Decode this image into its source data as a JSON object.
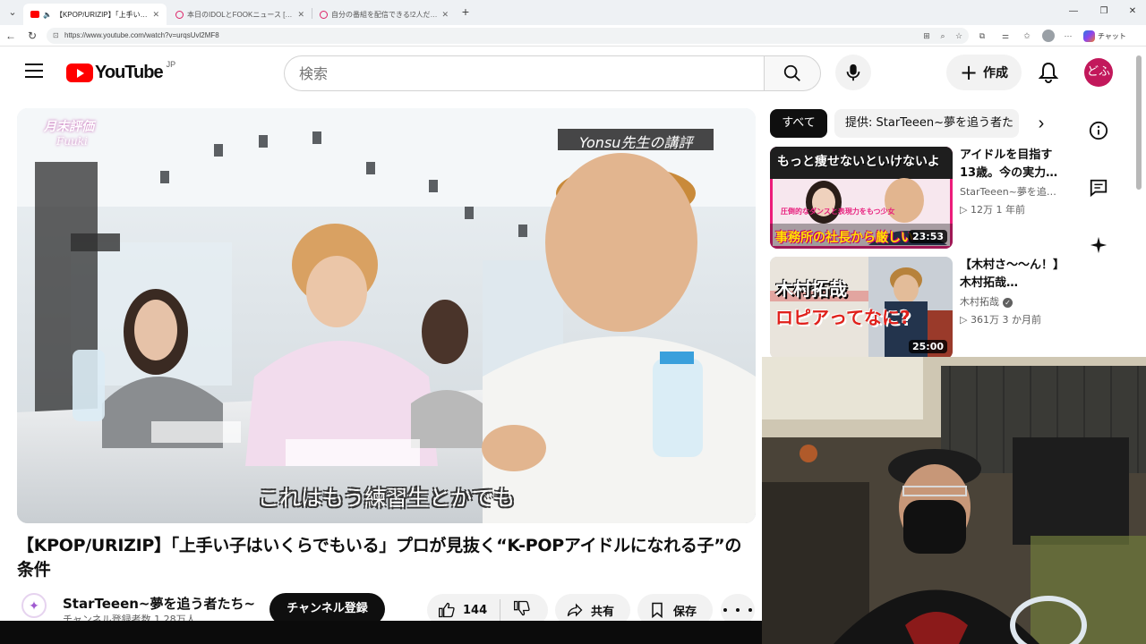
{
  "browser": {
    "tabs": [
      {
        "title": "【KPOP/URIZIP】「上手い子はい",
        "active": true
      },
      {
        "title": "本日のIDOLとFOOKニュース [ほどね]",
        "active": false
      },
      {
        "title": "自分の番組を配信できる!2人だけで!",
        "active": false
      }
    ],
    "url": "https://www.youtube.com/watch?v=urqsUvl2MF8",
    "copilot_label": "チャット"
  },
  "masthead": {
    "logo_text": "YouTube",
    "country_code": "JP",
    "search_placeholder": "検索",
    "create_label": "作成",
    "avatar_text": "どふ"
  },
  "player": {
    "subtitle": "これはもう練習生とかでも",
    "corner_label": "Yonsu先生の講評",
    "badge_line1": "月末評価",
    "badge_line2": "Fuuki"
  },
  "video": {
    "title": "【KPOP/URIZIP】「上手い子はいくらでもいる」プロが見抜く“K-POPアイドルになれる子”の条件",
    "channel_name": "StarTeeen~夢を追う者たち~",
    "channel_subs": "チャンネル登録者数 1.28万人",
    "subscribe_label": "チャンネル登録",
    "like_count": "144",
    "share_label": "共有",
    "save_label": "保存"
  },
  "sidebar": {
    "chips": [
      "すべて",
      "提供: StarTeeen~夢を追う者た"
    ],
    "recommendations": [
      {
        "title": "アイドルを目指す13歳。今の実力…",
        "channel": "StarTeeen~夢を追…",
        "views": "12万",
        "age": "1 年前",
        "duration": "23:53",
        "thumb_top": "もっと痩せないといけないよ",
        "thumb_mid": "圧倒的なダンスと表現力をもつ少女",
        "thumb_bottom": "事務所の社長から厳しい"
      },
      {
        "title": "【木村さ〜〜ん！】木村拓哉…",
        "channel": "木村拓哉",
        "views": "361万",
        "age": "3 か月前",
        "duration": "25:00",
        "thumb_top": "木村拓哉",
        "thumb_bottom": "ロピアってなに?"
      }
    ]
  },
  "icons": {
    "menu": "hamburger-icon",
    "search": "search-icon",
    "mic": "mic-icon",
    "bell": "bell-icon",
    "info": "info-icon",
    "chat": "chat-icon",
    "sparkle": "sparkle-icon"
  },
  "colors": {
    "brand_red": "#ff0000",
    "avatar_bg": "#c2185b",
    "chip_active_bg": "#0f0f0f"
  }
}
